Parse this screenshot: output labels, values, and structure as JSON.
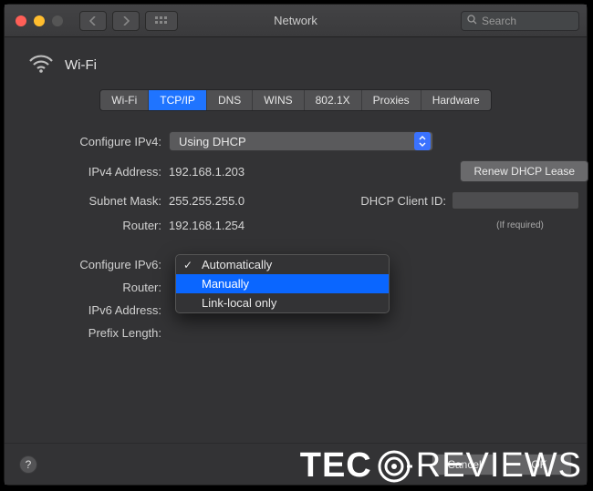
{
  "titlebar": {
    "title": "Network",
    "search_placeholder": "Search"
  },
  "header": {
    "title": "Wi-Fi"
  },
  "tabs": [
    {
      "label": "Wi-Fi",
      "active": false
    },
    {
      "label": "TCP/IP",
      "active": true
    },
    {
      "label": "DNS",
      "active": false
    },
    {
      "label": "WINS",
      "active": false
    },
    {
      "label": "802.1X",
      "active": false
    },
    {
      "label": "Proxies",
      "active": false
    },
    {
      "label": "Hardware",
      "active": false
    }
  ],
  "ipv4": {
    "configure_label": "Configure IPv4:",
    "configure_value": "Using DHCP",
    "address_label": "IPv4 Address:",
    "address_value": "192.168.1.203",
    "subnet_label": "Subnet Mask:",
    "subnet_value": "255.255.255.0",
    "router_label": "Router:",
    "router_value": "192.168.1.254",
    "renew_label": "Renew DHCP Lease",
    "client_id_label": "DHCP Client ID:",
    "client_id_value": "",
    "if_required": "(If required)"
  },
  "ipv6": {
    "configure_label": "Configure IPv6:",
    "router_label": "Router:",
    "address_label": "IPv6 Address:",
    "prefix_label": "Prefix Length:",
    "dropdown": {
      "options": [
        {
          "label": "Automatically",
          "checked": true,
          "highlighted": false
        },
        {
          "label": "Manually",
          "checked": false,
          "highlighted": true
        },
        {
          "label": "Link-local only",
          "checked": false,
          "highlighted": false
        }
      ]
    }
  },
  "footer": {
    "help": "?",
    "cancel": "Cancel",
    "ok": "OK"
  },
  "watermark": {
    "left": "TEC",
    "right": "REVIEWS"
  }
}
